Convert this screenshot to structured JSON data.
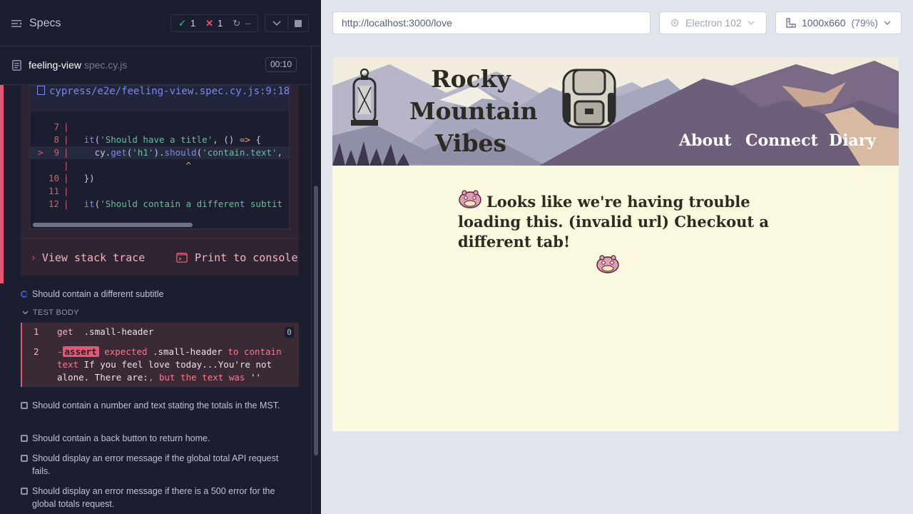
{
  "reporter": {
    "specs_label": "Specs",
    "stats": {
      "passed": "1",
      "failed": "1",
      "pending": "--"
    },
    "spec_file": {
      "name": "feeling-view",
      "ext": " spec.cy.js",
      "duration": "00:10"
    },
    "error": {
      "file_link": "cypress/e2e/feeling-view.spec.cy.js:9:18",
      "code_lines": [
        {
          "num": "7",
          "marker": "",
          "tokens": []
        },
        {
          "num": "8",
          "marker": "",
          "tokens": [
            {
              "t": "  ",
              "c": "tk-pl"
            },
            {
              "t": "it",
              "c": "tk-kw"
            },
            {
              "t": "(",
              "c": "tk-pl"
            },
            {
              "t": "'Should have a title'",
              "c": "tk-str"
            },
            {
              "t": ", () ",
              "c": "tk-pl"
            },
            {
              "t": "=>",
              "c": "tk-op"
            },
            {
              "t": " {",
              "c": "tk-pl"
            }
          ]
        },
        {
          "num": "9",
          "marker": ">",
          "tokens": [
            {
              "t": "    cy.",
              "c": "tk-pl"
            },
            {
              "t": "get",
              "c": "tk-kw"
            },
            {
              "t": "(",
              "c": "tk-pl"
            },
            {
              "t": "'h1'",
              "c": "tk-str"
            },
            {
              "t": ").",
              "c": "tk-pl"
            },
            {
              "t": "should",
              "c": "tk-kw"
            },
            {
              "t": "(",
              "c": "tk-pl"
            },
            {
              "t": "'contain.text'",
              "c": "tk-str"
            },
            {
              "t": ", '",
              "c": "tk-pl"
            }
          ]
        },
        {
          "num": "",
          "marker": "",
          "tokens": [
            {
              "t": "                     ",
              "c": "tk-pl"
            },
            {
              "t": "^",
              "c": "tk-op"
            }
          ]
        },
        {
          "num": "10",
          "marker": "",
          "tokens": [
            {
              "t": "  })",
              "c": "tk-pl"
            }
          ]
        },
        {
          "num": "11",
          "marker": "",
          "tokens": []
        },
        {
          "num": "12",
          "marker": "",
          "tokens": [
            {
              "t": "  ",
              "c": "tk-pl"
            },
            {
              "t": "it",
              "c": "tk-kw"
            },
            {
              "t": "(",
              "c": "tk-pl"
            },
            {
              "t": "'Should contain a different subtit",
              "c": "tk-str"
            }
          ]
        }
      ],
      "view_stack_label": "View stack trace",
      "print_console_label": "Print to console"
    },
    "running_test": "Should contain a different subtitle",
    "test_body_label": "TEST BODY",
    "commands": [
      {
        "num": "1",
        "name": "get",
        "message": ".small-header",
        "badge": "0"
      },
      {
        "num": "2",
        "chip": "assert",
        "expected": "expected",
        "subject": ".small-header",
        "to_contain": "to contain",
        "text_word": "text",
        "quote": "If you feel love today...You're not alone. There are:",
        "tail": ", but the text was",
        "empty": "''"
      }
    ],
    "pending_tests": [
      "Should contain a number and text stating the totals in the MST.",
      "Should contain a back button to return home.",
      "Should display an error message if the global total API request fails.",
      "Should display an error message if there is a 500 error for the global totals request."
    ]
  },
  "browser_chrome": {
    "url": "http://localhost:3000/love",
    "browser": "Electron 102",
    "viewport": "1000x660",
    "viewport_pct": "(79%)"
  },
  "app": {
    "site_title": "Rocky Mountain Vibes",
    "nav": [
      "About",
      "Connect",
      "Diary"
    ],
    "error_message": "Looks like we're having trouble loading this. (invalid url) Checkout a different tab!"
  },
  "colors": {
    "reporter_bg": "#1b1e2e",
    "fail": "#e45770",
    "pass": "#1fa971",
    "app_bg": "#fbf8e0"
  }
}
